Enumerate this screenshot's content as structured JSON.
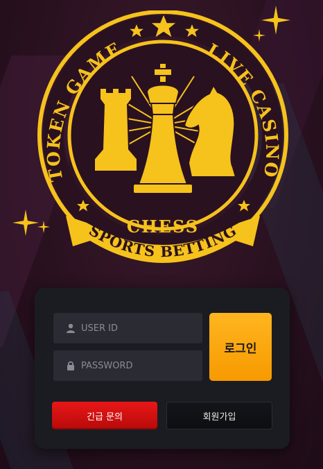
{
  "emblem": {
    "arc_left": "TOKEN GAME",
    "arc_right": "LIVE CASINO",
    "center": "CHESS",
    "banner": "SPORTS BETTING"
  },
  "login": {
    "user_id_placeholder": "USER ID",
    "password_placeholder": "PASSWORD",
    "login_label": "로그인",
    "urgent_inquiry_label": "긴급 문의",
    "signup_label": "회원가입"
  },
  "icons": {
    "user": "user-icon",
    "lock": "lock-icon"
  },
  "colors": {
    "gold": "#f6c21c",
    "login_button": "#fba612",
    "urgent_button": "#d61010",
    "panel": "#1b1c22"
  }
}
